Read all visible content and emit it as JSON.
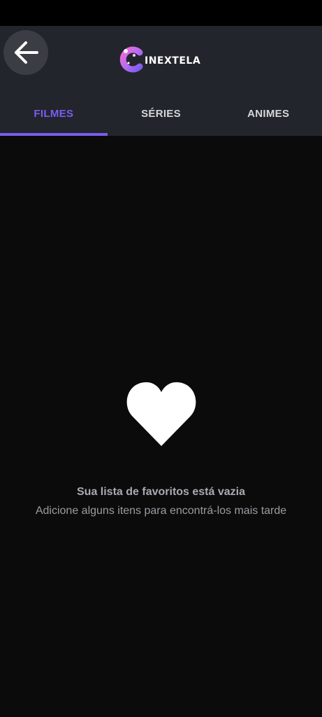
{
  "header": {
    "back_icon": "arrow-left-icon",
    "logo_text": "INEXTELA",
    "logo_icon": "cinextela-logo-c-icon"
  },
  "tabs": [
    {
      "label": "FILMES",
      "active": true
    },
    {
      "label": "SÉRIES",
      "active": false
    },
    {
      "label": "ANIMES",
      "active": false
    }
  ],
  "empty_state": {
    "icon": "heart-icon",
    "title": "Sua lista de favoritos está vazia",
    "subtitle": "Adicione alguns itens para encontrá-los mais tarde"
  },
  "colors": {
    "accent": "#7c5cf0",
    "app_bar": "#22252c",
    "background": "#0b0b0c"
  }
}
